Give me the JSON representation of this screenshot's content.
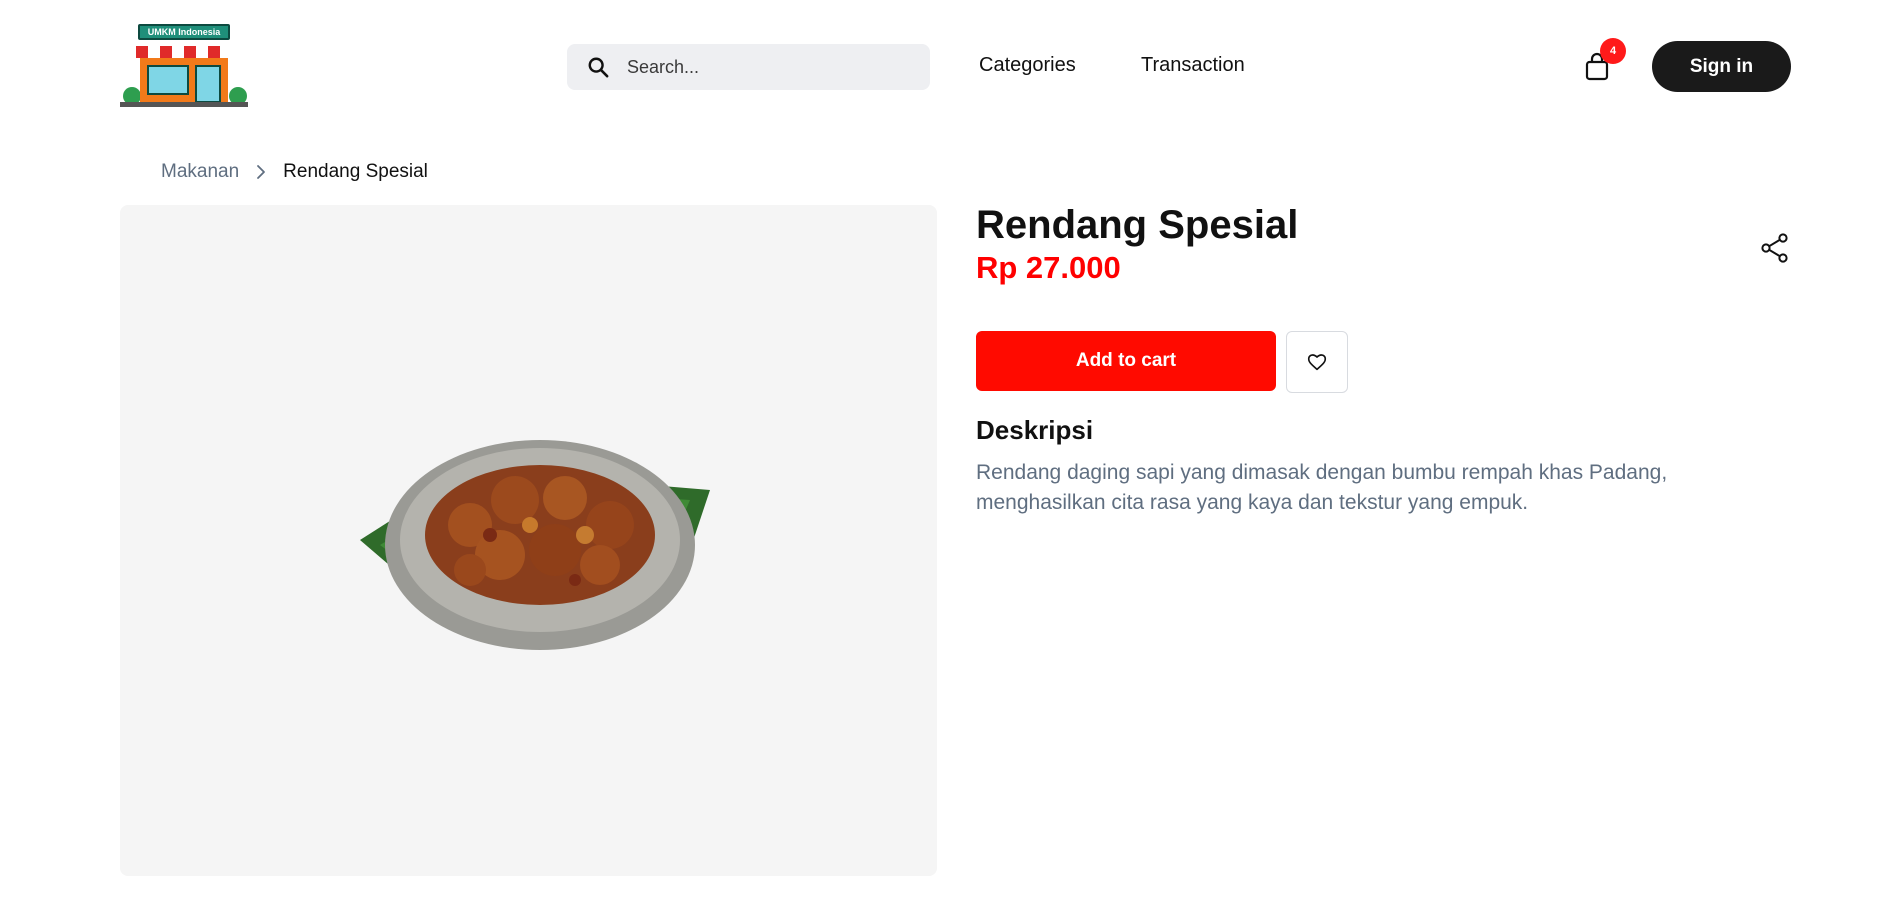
{
  "header": {
    "logo_text": "UMKM Indonesia",
    "search": {
      "placeholder": "Search..."
    },
    "nav": {
      "categories": "Categories",
      "transaction": "Transaction"
    },
    "cart_count": "4",
    "signin_label": "Sign in"
  },
  "breadcrumb": {
    "parent": "Makanan",
    "current": "Rendang Spesial"
  },
  "product": {
    "title": "Rendang Spesial",
    "price": "Rp 27.000",
    "add_to_cart_label": "Add to cart",
    "description_heading": "Deskripsi",
    "description": "Rendang daging sapi yang dimasak dengan bumbu rempah khas Padang, menghasilkan cita rasa yang kaya dan tekstur yang empuk."
  },
  "colors": {
    "accent_red": "#ff0a00",
    "price_red": "#ff0000",
    "dark_button": "#1a1a1a",
    "muted_text": "#5f6e80",
    "image_bg": "#f5f5f5",
    "search_bg": "#eeeff2"
  },
  "icons": {
    "logo": "shop-storefront-icon",
    "search": "search-icon",
    "cart": "shopping-bag-icon",
    "breadcrumb_sep": "chevron-right-icon",
    "share": "share-icon",
    "wishlist": "heart-icon"
  }
}
